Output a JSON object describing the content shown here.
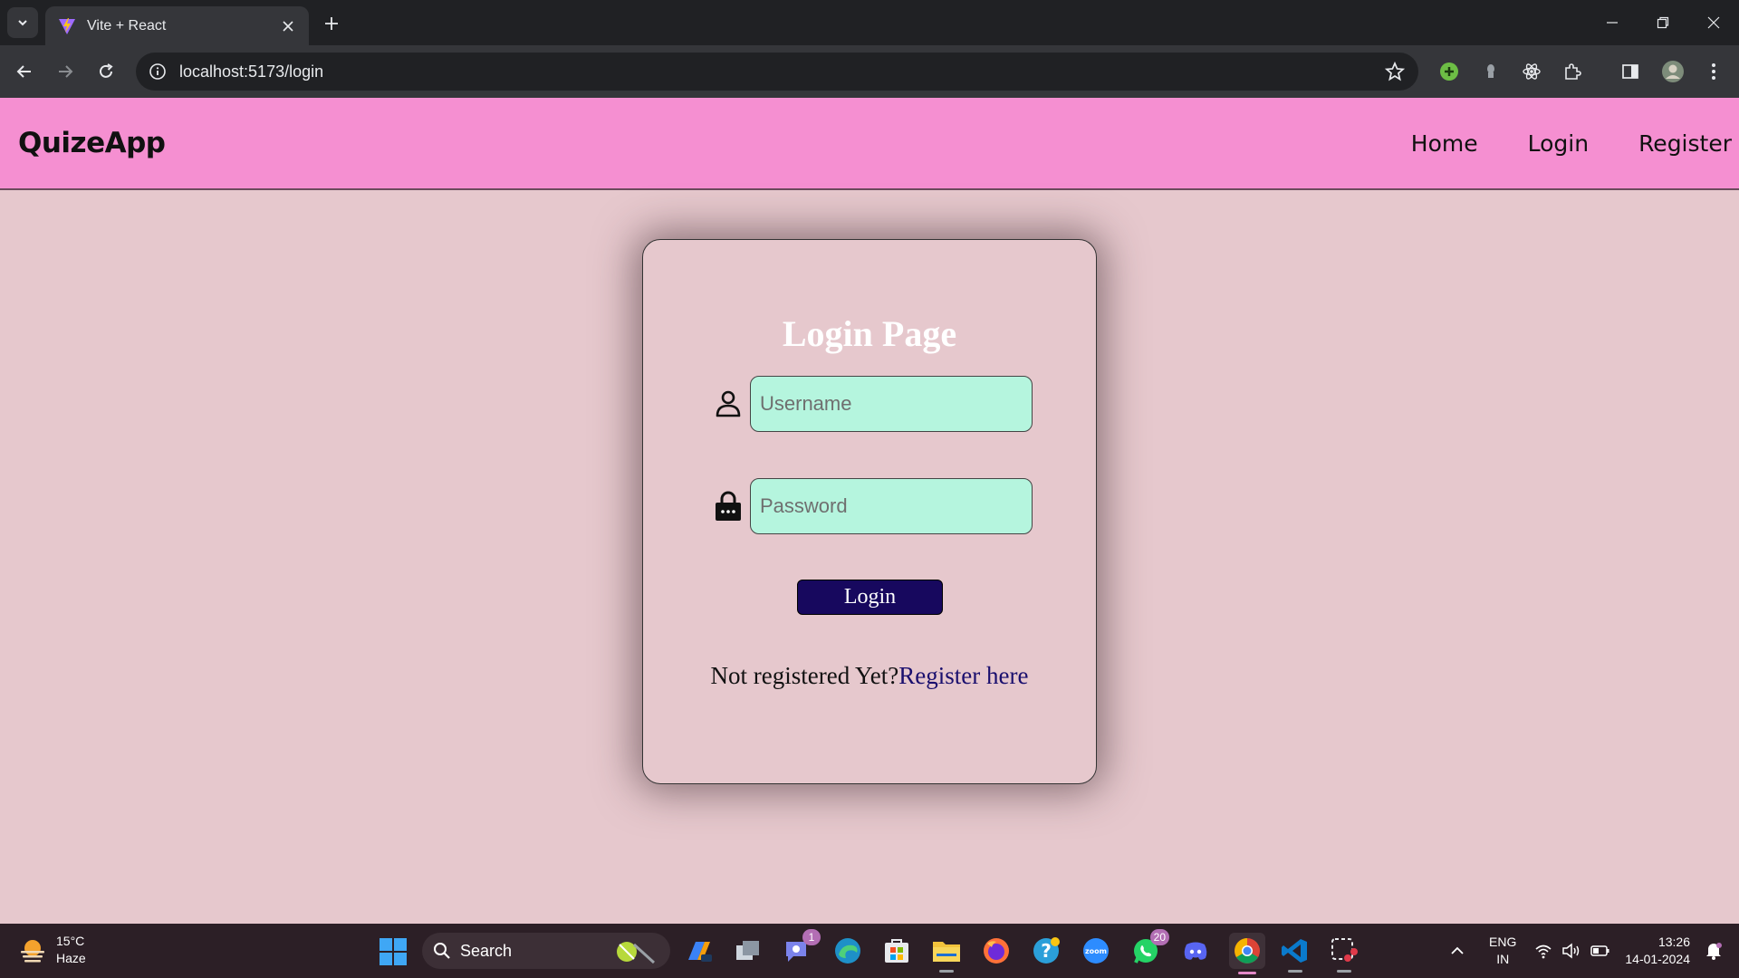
{
  "browser": {
    "tab_title": "Vite + React",
    "url": "localhost:5173/login"
  },
  "navbar": {
    "brand": "QuizeApp",
    "links": [
      "Home",
      "Login",
      "Register"
    ]
  },
  "login": {
    "title": "Login Page",
    "username_placeholder": "Username",
    "password_placeholder": "Password",
    "button_label": "Login",
    "register_prompt": "Not registered Yet?",
    "register_link": "Register here"
  },
  "taskbar": {
    "weather_temp": "15°C",
    "weather_desc": "Haze",
    "search_label": "Search",
    "teams_badge": "1",
    "whatsapp_badge": "20",
    "lang_top": "ENG",
    "lang_bottom": "IN",
    "time": "13:26",
    "date": "14-01-2024"
  },
  "colors": {
    "navbar": "#f58fd1",
    "page_bg": "#e6c8cd",
    "input_bg": "#b5f5de",
    "button_bg": "#17085e"
  }
}
